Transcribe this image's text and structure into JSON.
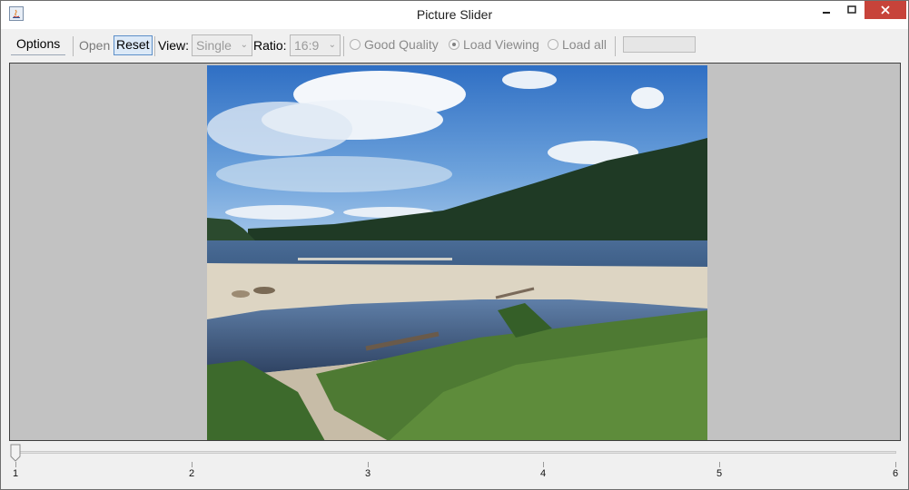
{
  "window": {
    "title": "Picture Slider",
    "minimize_icon": "minimize-icon",
    "maximize_icon": "maximize-icon",
    "close_icon": "close-icon"
  },
  "toolbar": {
    "options_label": "Options",
    "open_label": "Open",
    "reset_label": "Reset",
    "view_label": "View:",
    "view_value": "Single",
    "ratio_label": "Ratio:",
    "ratio_value": "16:9",
    "radio_good_quality": "Good Quality",
    "radio_load_viewing": "Load Viewing",
    "radio_load_all": "Load all",
    "selected_radio": "Load Viewing"
  },
  "viewer": {
    "image_description": "lake-landscape-photo",
    "background_color": "#c2c2c2"
  },
  "slider": {
    "value": 1,
    "min": 1,
    "max": 6,
    "tick_labels": [
      "1",
      "2",
      "3",
      "4",
      "5",
      "6"
    ]
  }
}
